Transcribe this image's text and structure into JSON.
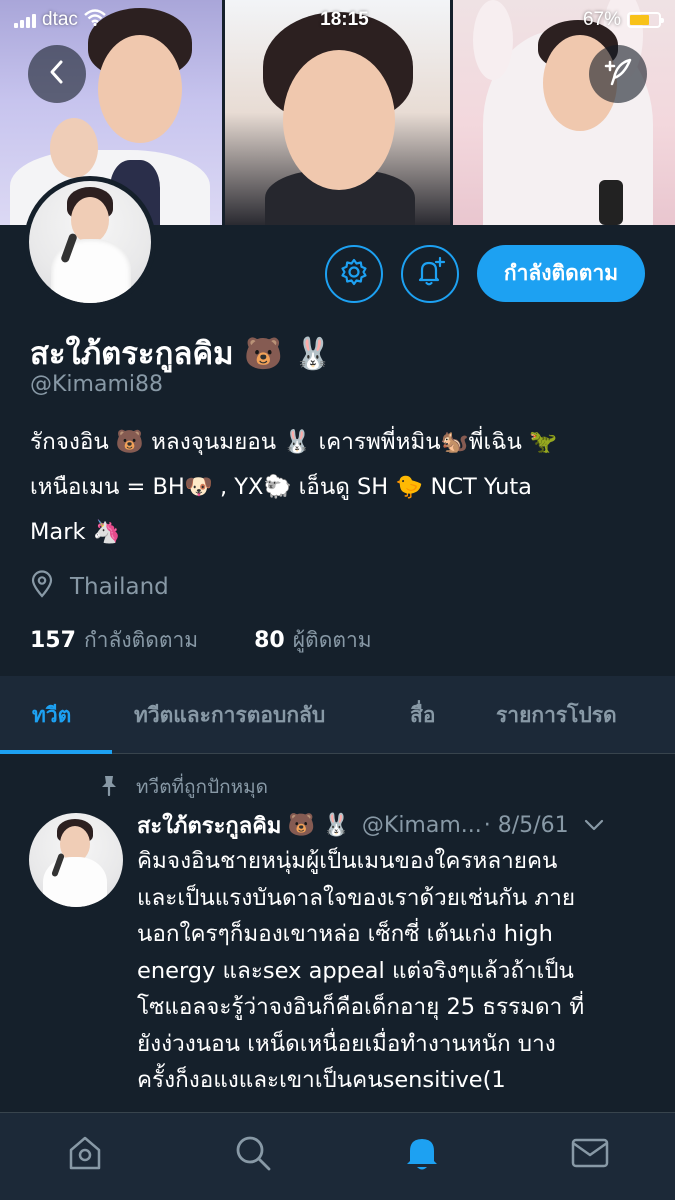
{
  "status_bar": {
    "carrier": "dtac",
    "time": "18:15",
    "battery": "67%",
    "battery_level": 0.67,
    "battery_color": "#f8c21a"
  },
  "header": {
    "back_icon": "back-arrow-icon",
    "compose_icon": "compose-tweet-icon"
  },
  "profile": {
    "name": "สะใภ้ตระกูลคิม",
    "name_emoji": "🐻 🐰",
    "handle": "@Kimami88",
    "bio_lines": [
      "รักจงอิน 🐻 หลงจุนมยอน 🐰 เคารพพี่หมิน🐿️พี่เฉิน 🦖",
      "เหนือเมน = BH🐶 , YX🐑 เอ็นดู SH 🐤 NCT Yuta",
      "Mark 🦄"
    ],
    "location": "Thailand",
    "following_count": "157",
    "following_label": "กำลังติดตาม",
    "followers_count": "80",
    "followers_label": "ผู้ติดตาม"
  },
  "actions": {
    "settings_icon": "gear-icon",
    "notify_icon": "bell-plus-icon",
    "follow_label": "กำลังติดตาม"
  },
  "tabs": [
    {
      "label": "ทวีต",
      "active": true
    },
    {
      "label": "ทวีตและการตอบกลับ",
      "active": false
    },
    {
      "label": "สื่อ",
      "active": false
    },
    {
      "label": "รายการโปรด",
      "active": false
    }
  ],
  "tweet": {
    "pinned_label": "ทวีตที่ถูกปักหมุด",
    "author": "สะใภ้ตระกูลคิม",
    "author_emoji": "🐻 🐰",
    "handle": "@Kimam...",
    "date": "· 8/5/61",
    "body_lines": [
      "คิมจงอินชายหนุ่มผู้เป็นเมนของใครหลายคน",
      "และเป็นแรงบันดาลใจของเราด้วยเช่นกัน ภาย",
      "นอกใครๆก็มองเขาหล่อ เซ็กซี่ เต้นเก่ง high",
      "energy และsex appeal แต่จริงๆแล้วถ้าเป็น",
      "โซแอลจะรู้ว่าจงอินก็คือเด็กอายุ 25 ธรรมดา ที่",
      "ยังง่วงนอน เหน็ดเหนื่อยเมื่อทำงานหนัก บาง",
      "ครั้งก็งอแงและเขาเป็นคนsensitive(1"
    ]
  },
  "bottom_nav": [
    {
      "icon": "home-icon",
      "active": false
    },
    {
      "icon": "search-icon",
      "active": false
    },
    {
      "icon": "notifications-bell-icon",
      "active": true
    },
    {
      "icon": "messages-mail-icon",
      "active": false
    }
  ],
  "colors": {
    "background": "#15202b",
    "bar_background": "#1c2938",
    "accent": "#1da1f2",
    "secondary_text": "#8899a6"
  }
}
